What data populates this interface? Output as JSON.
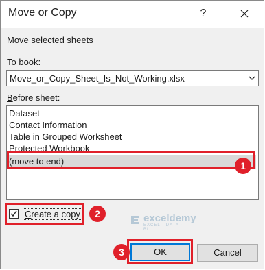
{
  "dialog": {
    "title": "Move or Copy",
    "help_label": "?",
    "close_icon": "close-icon"
  },
  "main": {
    "heading": "Move selected sheets",
    "to_book_label_first": "T",
    "to_book_label_rest": "o book:",
    "to_book_value": "Move_or_Copy_Sheet_Is_Not_Working.xlsx",
    "before_sheet_label_first": "B",
    "before_sheet_label_rest": "efore sheet:",
    "sheets": [
      {
        "label": "Dataset"
      },
      {
        "label": "Contact Information"
      },
      {
        "label": "Table in Grouped Worksheet"
      },
      {
        "label": "Protected Workbook"
      },
      {
        "label": "(move to end)"
      }
    ],
    "create_copy_first": "C",
    "create_copy_rest": "reate a copy",
    "create_copy_checked": true
  },
  "buttons": {
    "ok": "OK",
    "cancel": "Cancel"
  },
  "annotations": {
    "badge1": "1",
    "badge2": "2",
    "badge3": "3",
    "color": "#e0202a"
  },
  "watermark": {
    "name": "exceldemy",
    "tagline": "EXCEL · DATA · BI"
  }
}
